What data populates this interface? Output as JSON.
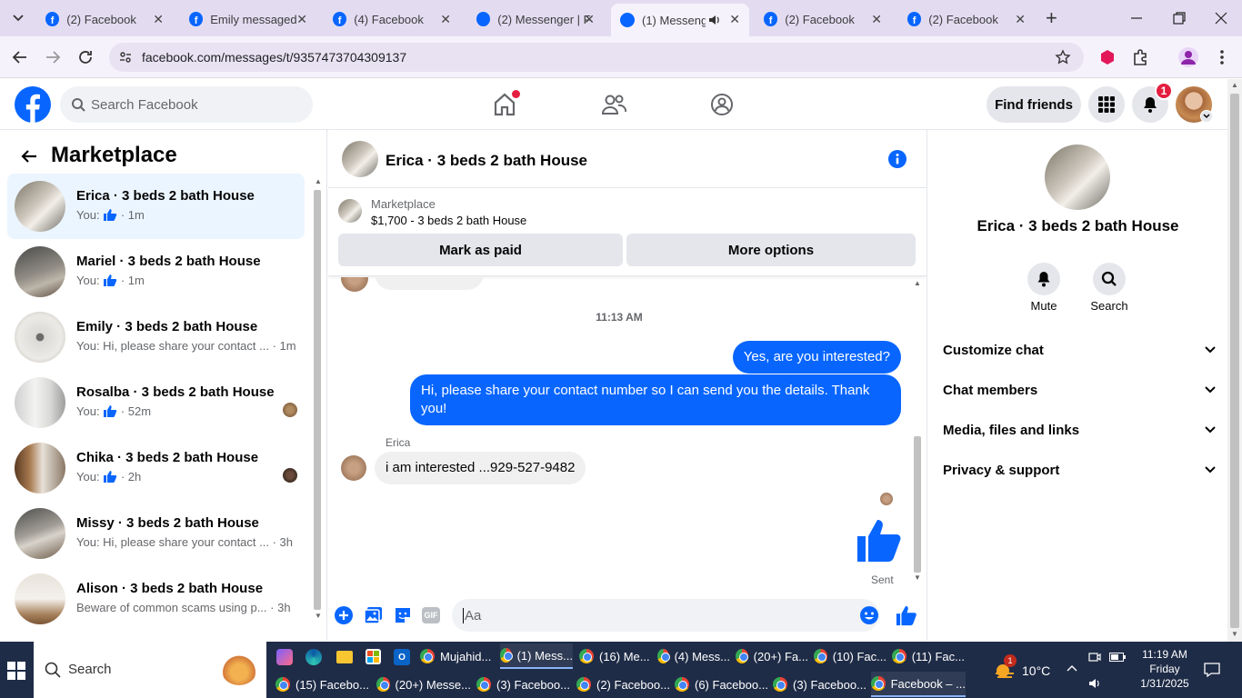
{
  "browser": {
    "tabs": [
      {
        "title": "(2) Facebook"
      },
      {
        "title": "Emily messaged"
      },
      {
        "title": "(4) Facebook"
      },
      {
        "title": "(2) Messenger | F"
      },
      {
        "title": "(1) Messeng"
      },
      {
        "title": "(2) Facebook"
      },
      {
        "title": "(2) Facebook"
      }
    ],
    "url": "facebook.com/messages/t/9357473704309137"
  },
  "fb": {
    "search_placeholder": "Search Facebook",
    "find_friends": "Find friends",
    "notif_count": "1"
  },
  "left": {
    "title": "Marketplace",
    "conversations": [
      {
        "name": "Erica · 3 beds 2 bath House",
        "sub": "You:",
        "time": "· 1m"
      },
      {
        "name": "Mariel · 3 beds 2 bath House",
        "sub": "You:",
        "time": "· 1m"
      },
      {
        "name": "Emily · 3 beds 2 bath House",
        "sub": "You: Hi, please share your contact ... · 1m"
      },
      {
        "name": "Rosalba · 3 beds 2 bath House",
        "sub": "You:",
        "time": "· 52m"
      },
      {
        "name": "Chika · 3 beds 2 bath House",
        "sub": "You:",
        "time": "· 2h"
      },
      {
        "name": "Missy · 3 beds 2 bath House",
        "sub": "You: Hi, please share your contact ... · 3h"
      },
      {
        "name": "Alison · 3 beds 2 bath House",
        "sub": "Beware of common scams using p... · 3h"
      }
    ]
  },
  "chat": {
    "title": "Erica · 3 beds 2 bath House",
    "listing_label": "Marketplace",
    "listing_title": "$1,700 - 3 beds 2 bath House",
    "mark_paid": "Mark as paid",
    "more_options": "More options",
    "timestamp": "11:13 AM",
    "msg1": "Yes, are you interested?",
    "msg2": "Hi, please share your contact number so I can send you the details. Thank you!",
    "sender": "Erica",
    "msg3": "i am interested ...929-527-9482",
    "sent": "Sent",
    "input_placeholder": "Aa"
  },
  "right": {
    "name": "Erica · 3 beds 2 bath House",
    "mute": "Mute",
    "search": "Search",
    "sections": [
      "Customize chat",
      "Chat members",
      "Media, files and links",
      "Privacy & support"
    ]
  },
  "taskbar": {
    "search": "Search",
    "row1": [
      "Mujahid...",
      "(1) Mess...",
      "(16) Me...",
      "(4) Mess...",
      "(20+) Fa...",
      "(10) Fac...",
      "(11) Fac..."
    ],
    "row2": [
      "(15) Facebo...",
      "(20+) Messe...",
      "(3) Faceboo...",
      "(2) Faceboo...",
      "(6) Faceboo...",
      "(3) Faceboo...",
      "Facebook – ..."
    ],
    "weather": "10°C",
    "weather_badge": "1",
    "time": "11:19 AM",
    "day": "Friday",
    "date": "1/31/2025"
  },
  "colors": {
    "fb_blue": "#0866ff",
    "notif_red": "#e41e3f",
    "tab_bg": "#e3dcf1"
  }
}
